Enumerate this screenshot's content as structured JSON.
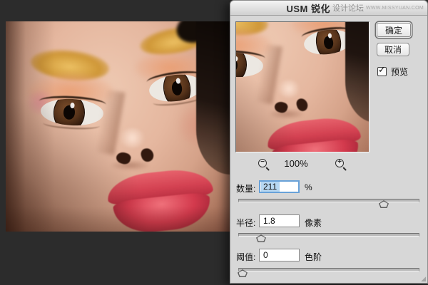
{
  "dialog": {
    "title": "USM 锐化",
    "watermark": "设计论坛",
    "watermark_url": "WWW.MISSYUAN.COM",
    "buttons": {
      "ok": "确定",
      "cancel": "取消"
    },
    "preview_checkbox": {
      "label": "预览",
      "checked": true
    },
    "zoom": {
      "level": "100%"
    },
    "fields": [
      {
        "label": "数量:",
        "value": "211",
        "unit": "%",
        "slider_pos": "78%"
      },
      {
        "label": "半径:",
        "value": "1.8",
        "unit": "像素",
        "slider_pos": "10%"
      },
      {
        "label": "阈值:",
        "value": "0",
        "unit": "色阶",
        "slider_pos": "0%"
      }
    ]
  },
  "icons": {
    "checkmark": "✓",
    "zoom_out_glyph": "−",
    "zoom_in_glyph": "+",
    "resize_grip": "◢"
  },
  "colors": {
    "workspace_bg": "#2c2c2c",
    "dialog_bg": "#d7d7d7",
    "focus_blue": "#68a1d8",
    "selection_blue": "#b7d7f1",
    "lip_red": "#d33a4d",
    "skin": "#e5b79f",
    "hair": "#201510"
  }
}
